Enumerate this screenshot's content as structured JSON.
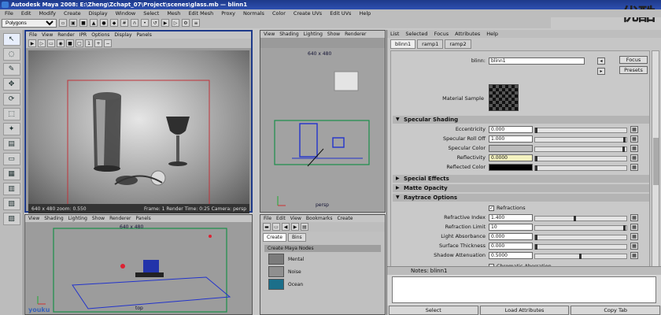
{
  "window": {
    "title": "Autodesk Maya 2008: E:\\Zheng\\Zchapt_07\\Project\\scenes\\glass.mb — blinn1"
  },
  "brand": "优酷",
  "menubar": [
    "File",
    "Edit",
    "Modify",
    "Create",
    "Display",
    "Window",
    "Select",
    "Mesh",
    "Edit Mesh",
    "Proxy",
    "Normals",
    "Color",
    "Create UVs",
    "Edit UVs",
    "Help"
  ],
  "toolbar": {
    "mode": "Polygons"
  },
  "render_view": {
    "menu": [
      "File",
      "View",
      "Render",
      "IPR",
      "Options",
      "Display",
      "Panels"
    ],
    "status_left": "640 x 480 zoom: 0.550",
    "status_right": "Frame: 1   Render Time: 0:25   Camera: persp"
  },
  "persp_view": {
    "menu": [
      "View",
      "Shading",
      "Lighting",
      "Show",
      "Renderer",
      "Panels"
    ],
    "res": "640 x 480",
    "cam": "persp"
  },
  "top_view": {
    "menu": [
      "View",
      "Shading",
      "Lighting",
      "Show",
      "Renderer",
      "Panels"
    ],
    "res": "640 x 480",
    "cam": "top"
  },
  "hypershade": {
    "menu": [
      "File",
      "Edit",
      "View",
      "Bookmarks",
      "Create"
    ],
    "tabs": [
      "Create",
      "Bins"
    ],
    "header": "Create Maya Nodes",
    "items": [
      {
        "label": "Mental",
        "color": "#7b7b7b"
      },
      {
        "label": "Noise",
        "color": "#8f8f8f"
      },
      {
        "label": "Ocean",
        "color": "#1c6f8a"
      }
    ]
  },
  "attr_editor": {
    "menu": [
      "List",
      "Selected",
      "Focus",
      "Attributes",
      "Help"
    ],
    "tabs": [
      "blinn1",
      "ramp1",
      "ramp2"
    ],
    "node_label": "blinn:",
    "node_value": "blinn1",
    "focus_btn": "Focus",
    "presets_btn": "Presets",
    "material_sample": "Material Sample",
    "sections": {
      "specular": "Specular Shading",
      "effects": "Special Effects",
      "matte": "Matte Opacity",
      "raytrace": "Raytrace Options"
    },
    "specular_rows": [
      {
        "label": "Eccentricity",
        "value": "0.000",
        "level": 0.0
      },
      {
        "label": "Specular Roll Off",
        "value": "1.000",
        "level": 1.0
      },
      {
        "label": "Specular Color",
        "value": "",
        "level": 0.99
      },
      {
        "label": "Reflectivity",
        "value": "0.0000",
        "level": 0.0
      },
      {
        "label": "Reflected Color",
        "value": "",
        "level": 0.0
      }
    ],
    "refractions_label": "Refractions",
    "raytrace_rows": [
      {
        "label": "Refractive Index",
        "value": "1.400",
        "level": 0.44
      },
      {
        "label": "Refraction Limit",
        "value": "10",
        "level": 1.0
      },
      {
        "label": "Light Absorbance",
        "value": "0.000",
        "level": 0.0
      },
      {
        "label": "Surface Thickness",
        "value": "0.000",
        "level": 0.0
      },
      {
        "label": "Shadow Attenuation",
        "value": "0.5000",
        "level": 0.5
      }
    ],
    "chromatic": "Chromatic Aberration",
    "notes_title": "Notes: blinn1",
    "buttons": [
      "Select",
      "Load Attributes",
      "Copy Tab"
    ]
  },
  "watermark": "youku"
}
